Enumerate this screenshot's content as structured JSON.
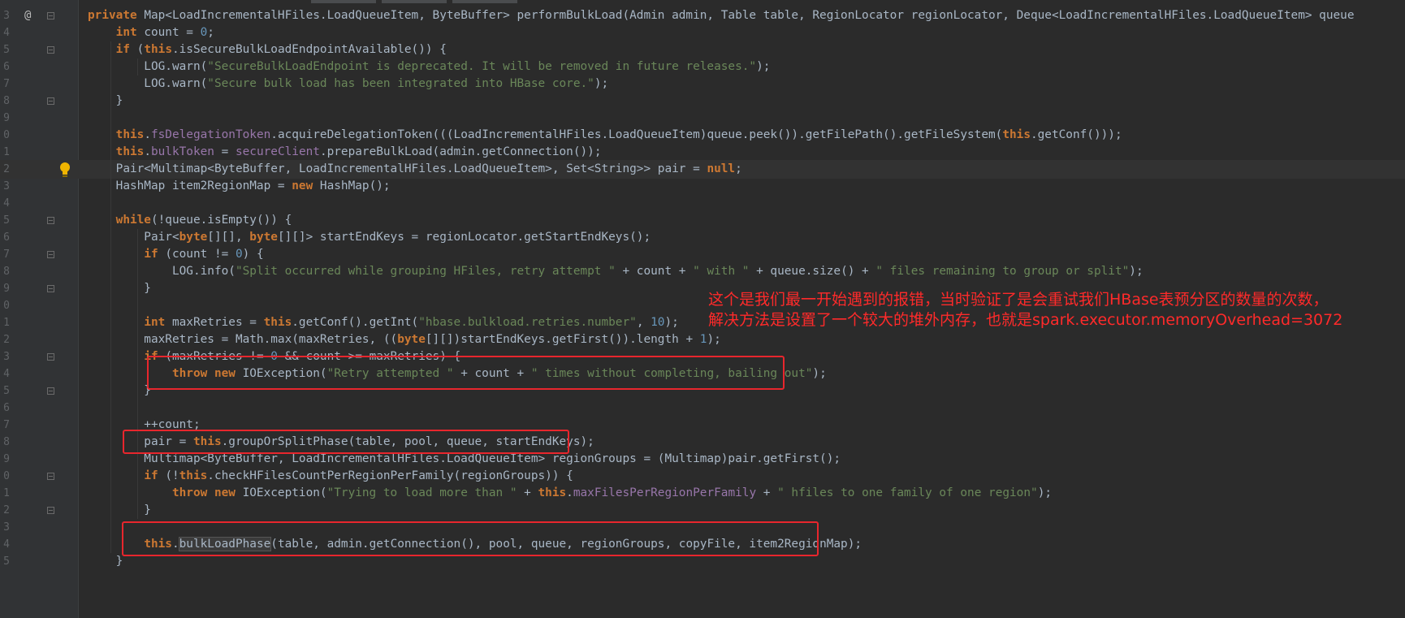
{
  "editor": {
    "colors": {
      "background": "#2b2b2b",
      "keyword": "#cc7832",
      "string": "#6a8759",
      "number": "#6897bb",
      "field": "#9876aa",
      "annotation": "#ff2a2a",
      "highlight_box": "#e8262d"
    },
    "gutter": {
      "override_marker": "@",
      "bulb_icon": "lightbulb-icon"
    },
    "line_numbers": [
      "3",
      "4",
      "5",
      "6",
      "7",
      "8",
      "9",
      "0",
      "1",
      "2",
      "3",
      "4",
      "5",
      "6",
      "7",
      "8",
      "9",
      "0",
      "1",
      "2",
      "3",
      "4",
      "5",
      "6",
      "7",
      "8",
      "9",
      "0",
      "1",
      "2",
      "3",
      "4",
      "5"
    ],
    "code_lines": [
      [
        [
          "kw",
          "private "
        ],
        [
          "t",
          "Map<LoadIncrementalHFiles.LoadQueueItem, ByteBuffer> performBulkLoad(Admin admin, Table table, RegionLocator regionLocator, Deque<LoadIncrementalHFiles.LoadQueueItem> queue"
        ]
      ],
      [
        [
          "t",
          "    "
        ],
        [
          "kw",
          "int "
        ],
        [
          "t",
          "count = "
        ],
        [
          "num",
          "0"
        ],
        [
          "t",
          ";"
        ]
      ],
      [
        [
          "t",
          "    "
        ],
        [
          "kw",
          "if "
        ],
        [
          "t",
          "("
        ],
        [
          "kw",
          "this"
        ],
        [
          "t",
          ".isSecureBulkLoadEndpointAvailable()) {"
        ]
      ],
      [
        [
          "t",
          "        LOG.warn("
        ],
        [
          "str",
          "\"SecureBulkLoadEndpoint is deprecated. It will be removed in future releases.\""
        ],
        [
          "t",
          ");"
        ]
      ],
      [
        [
          "t",
          "        LOG.warn("
        ],
        [
          "str",
          "\"Secure bulk load has been integrated into HBase core.\""
        ],
        [
          "t",
          ");"
        ]
      ],
      [
        [
          "t",
          "    }"
        ]
      ],
      [
        [
          "t",
          ""
        ]
      ],
      [
        [
          "t",
          "    "
        ],
        [
          "kw",
          "this"
        ],
        [
          "t",
          "."
        ],
        [
          "fld",
          "fsDelegationToken"
        ],
        [
          "t",
          ".acquireDelegationToken(((LoadIncrementalHFiles.LoadQueueItem)queue.peek()).getFilePath().getFileSystem("
        ],
        [
          "kw",
          "this"
        ],
        [
          "t",
          ".getConf()));"
        ]
      ],
      [
        [
          "t",
          "    "
        ],
        [
          "kw",
          "this"
        ],
        [
          "t",
          "."
        ],
        [
          "fld",
          "bulkToken"
        ],
        [
          "t",
          " = "
        ],
        [
          "fld",
          "secureClient"
        ],
        [
          "t",
          ".prepareBulkLoad(admin.getConnection());"
        ]
      ],
      [
        [
          "t",
          "    Pair<Multimap<ByteBuffer, LoadIncrementalHFiles.LoadQueueItem>, Set<String>> pair = "
        ],
        [
          "kw",
          "null"
        ],
        [
          "t",
          ";"
        ]
      ],
      [
        [
          "t",
          "    HashMap item2RegionMap = "
        ],
        [
          "kw",
          "new "
        ],
        [
          "t",
          "HashMap();"
        ]
      ],
      [
        [
          "t",
          ""
        ]
      ],
      [
        [
          "t",
          "    "
        ],
        [
          "kw",
          "while"
        ],
        [
          "t",
          "(!queue.isEmpty()) {"
        ]
      ],
      [
        [
          "t",
          "        Pair<"
        ],
        [
          "kw",
          "byte"
        ],
        [
          "t",
          "[][], "
        ],
        [
          "kw",
          "byte"
        ],
        [
          "t",
          "[][]> startEndKeys = regionLocator.getStartEndKeys();"
        ]
      ],
      [
        [
          "t",
          "        "
        ],
        [
          "kw",
          "if "
        ],
        [
          "t",
          "(count != "
        ],
        [
          "num",
          "0"
        ],
        [
          "t",
          ") {"
        ]
      ],
      [
        [
          "t",
          "            LOG.info("
        ],
        [
          "str",
          "\"Split occurred while grouping HFiles, retry attempt \""
        ],
        [
          "t",
          " + count + "
        ],
        [
          "str",
          "\" with \""
        ],
        [
          "t",
          " + queue.size() + "
        ],
        [
          "str",
          "\" files remaining to group or split\""
        ],
        [
          "t",
          ");"
        ]
      ],
      [
        [
          "t",
          "        }"
        ]
      ],
      [
        [
          "t",
          ""
        ]
      ],
      [
        [
          "t",
          "        "
        ],
        [
          "kw",
          "int "
        ],
        [
          "t",
          "maxRetries = "
        ],
        [
          "kw",
          "this"
        ],
        [
          "t",
          ".getConf().getInt("
        ],
        [
          "str",
          "\"hbase.bulkload.retries.number\""
        ],
        [
          "t",
          ", "
        ],
        [
          "num",
          "10"
        ],
        [
          "t",
          ");"
        ]
      ],
      [
        [
          "t",
          "        maxRetries = Math.max(maxRetries, (("
        ],
        [
          "kw",
          "byte"
        ],
        [
          "t",
          "[][])startEndKeys.getFirst()).length + "
        ],
        [
          "num",
          "1"
        ],
        [
          "t",
          ");"
        ]
      ],
      [
        [
          "t",
          "        "
        ],
        [
          "kw",
          "if "
        ],
        [
          "t",
          "(maxRetries != "
        ],
        [
          "num",
          "0"
        ],
        [
          "t",
          " && count >= maxRetries) {"
        ]
      ],
      [
        [
          "t",
          "            "
        ],
        [
          "kw",
          "throw new "
        ],
        [
          "t",
          "IOException("
        ],
        [
          "str",
          "\"Retry attempted \""
        ],
        [
          "t",
          " + count + "
        ],
        [
          "str",
          "\" times without completing, bailing out\""
        ],
        [
          "t",
          ");"
        ]
      ],
      [
        [
          "t",
          "        }"
        ]
      ],
      [
        [
          "t",
          ""
        ]
      ],
      [
        [
          "t",
          "        ++count;"
        ]
      ],
      [
        [
          "t",
          "        pair = "
        ],
        [
          "kw",
          "this"
        ],
        [
          "t",
          ".groupOrSplitPhase(table, pool, queue, startEndKeys);"
        ]
      ],
      [
        [
          "t",
          "        Multimap<ByteBuffer, LoadIncrementalHFiles.LoadQueueItem> regionGroups = (Multimap)pair.getFirst();"
        ]
      ],
      [
        [
          "t",
          "        "
        ],
        [
          "kw",
          "if "
        ],
        [
          "t",
          "(!"
        ],
        [
          "kw",
          "this"
        ],
        [
          "t",
          ".checkHFilesCountPerRegionPerFamily(regionGroups)) {"
        ]
      ],
      [
        [
          "t",
          "            "
        ],
        [
          "kw",
          "throw new "
        ],
        [
          "t",
          "IOException("
        ],
        [
          "str",
          "\"Trying to load more than \""
        ],
        [
          "t",
          " + "
        ],
        [
          "kw",
          "this"
        ],
        [
          "t",
          "."
        ],
        [
          "fld",
          "maxFilesPerRegionPerFamily"
        ],
        [
          "t",
          " + "
        ],
        [
          "str",
          "\" hfiles to one family of one region\""
        ],
        [
          "t",
          ");"
        ]
      ],
      [
        [
          "t",
          "        }"
        ]
      ],
      [
        [
          "t",
          ""
        ]
      ],
      [
        [
          "t",
          "        "
        ],
        [
          "kw",
          "this"
        ],
        [
          "t",
          "."
        ],
        [
          "hl",
          "bulkLoadPhase"
        ],
        [
          "t",
          "(table, admin.getConnection(), pool, queue, regionGroups, copyFile, item2RegionMap);"
        ]
      ],
      [
        [
          "t",
          "    }"
        ]
      ]
    ],
    "annotation": {
      "line1": "这个是我们最一开始遇到的报错，当时验证了是会重试我们HBase表预分区的数量的次数，",
      "line2": "解决方法是设置了一个较大的堆外内存，也就是spark.executor.memoryOverhead=3072"
    }
  }
}
